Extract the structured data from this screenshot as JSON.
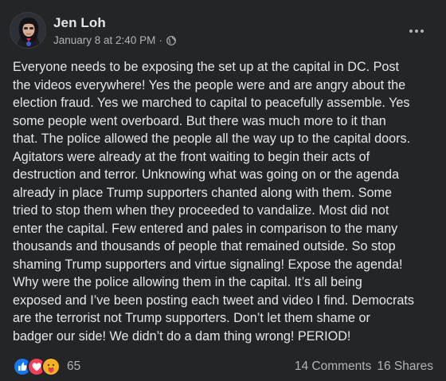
{
  "post": {
    "author": "Jen Loh",
    "date": "January 8 at 2:40 PM",
    "separator": "·",
    "privacy_icon": "globe-icon",
    "more_icon": "more-options-icon",
    "text": "Everyone needs to be exposing the set up at the capital in DC. Post\nthe videos everywhere! Yes the people were and are angry about the\nelection fraud. Yes we marched to capital to peacefully assemble. Yes\nsome people went overboard. But there was much more to it than\nthat. The police allowed the people all the way up to the capital doors.\nAgitators were already at the front waiting to begin their acts of\ndestruction and terror. Unknowing what was going on or the agenda\nalready in place Trump supporters chanted along with them. Some\ntried to stop them when they proceeded to vandalize. Most did not\nenter the capital. Few entered and pales in comparison to the many\nthousands and thousands of people that remained outside. So stop\nshaming Trump supporters and virtue signaling! Expose the agenda!\nWhy were the police allowing them in the capital. It’s all being\nexposed and I’ve been posting each tweet and video I find. Democrats\nare the terrorist not Trump supporters. Don’t let them shame or\nbadger our side! We didn’t do a dam thing wrong! PERIOD!"
  },
  "footer": {
    "reactions": [
      {
        "name": "like-reaction-icon",
        "color": "#1877f2"
      },
      {
        "name": "love-reaction-icon",
        "color": "#f33e58"
      },
      {
        "name": "care-reaction-icon",
        "color": "#f7b125"
      }
    ],
    "reaction_count": "65",
    "comments": "14 Comments",
    "shares": "16 Shares"
  },
  "colors": {
    "background": "#242526",
    "primary_text": "#e4e6eb",
    "secondary_text": "#b0b3b8"
  }
}
